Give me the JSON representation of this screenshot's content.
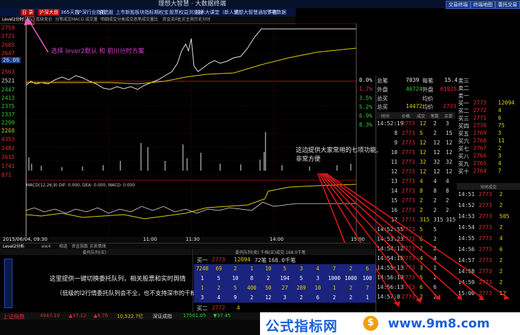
{
  "window": {
    "title": "理想大智慧 · 大数据终端",
    "right_buttons": [
      "交易终端",
      "终端地图",
      "委托交易"
    ]
  },
  "menu": {
    "items": [
      "目 录",
      "沪深大盘",
      "365天数",
      "沪深行业指数",
      "自选股",
      "上市新股",
      "板块指标",
      "期权宝",
      "股票权益浏览器",
      "技术大课堂（新人式）",
      "理想大智慧通软件官",
      "下载数据"
    ]
  },
  "tabs": [
    "Level2分时",
    "ADL",
    "连续竞价",
    "分笔成交",
    "MACD",
    "成交量",
    "明细成交",
    "分类成交",
    "逐笔成交",
    "量比",
    "资金流向",
    "主买主卖",
    "历史分时"
  ],
  "chart": {
    "left_prices": [
      {
        "v": "2759",
        "c": "r"
      },
      {
        "v": "2721",
        "c": "r"
      },
      {
        "v": "2685",
        "c": "r"
      },
      {
        "v": "2647",
        "c": "r"
      },
      {
        "v": "26.09",
        "c": "w"
      },
      {
        "v": "2563",
        "c": "r"
      },
      {
        "v": "2521",
        "c": "w"
      },
      {
        "v": "2447",
        "c": "g"
      },
      {
        "v": "2413",
        "c": "g"
      },
      {
        "v": "2375",
        "c": "g"
      },
      {
        "v": "2337",
        "c": "g"
      },
      {
        "v": "2299",
        "c": "g"
      },
      {
        "v": "2260",
        "c": "g"
      }
    ],
    "right_percents": [
      "0.0%",
      "1.7%",
      "3.5%",
      "5.2%",
      "6.9%",
      "8.3%"
    ],
    "volume_labels": [
      "5223",
      "4353",
      "3482",
      "2612",
      "1741",
      "871"
    ],
    "macd_header": "MACD(12,26,9) DIF: 0.000, DEA: 0.000, MACD: 0.000",
    "time_labels": [
      "11:00",
      "11:30",
      "14:00",
      "15:00"
    ],
    "current_time": "2015/06/04, 09:30"
  },
  "annotations": {
    "select_level2": "选择 lever2默认 和 前川分时方案",
    "seven_functions_1": "这边提供大家常用的七项功能,",
    "seven_functions_2": "非常方便",
    "one_key_1": "这里提供一键切换委托队列，相关股票和实时舆情",
    "one_key_2": "（低级的l2行情委托队列会不全，也不支持深市的千档）"
  },
  "right_panel": {
    "stats": [
      {
        "k1": "总笔",
        "v1": "7039",
        "k2": "每笔",
        "v2": "15.4"
      },
      {
        "k1": "外盘",
        "v1": "46724",
        "k2": "外盘",
        "v2": "61925"
      },
      {
        "k1": "总买",
        "v1": "",
        "k2": "均价",
        "v2": ""
      },
      {
        "k1": "总买",
        "v1": "14472",
        "k2": "均价",
        "v2": "2733"
      }
    ],
    "order_side": [
      {
        "k": "卖三",
        "v": ""
      },
      {
        "k": "卖二",
        "v": ""
      },
      {
        "k": "卖一",
        "v": ""
      },
      {
        "k": "买一",
        "v": "2773",
        "n": "12094"
      },
      {
        "k": "买二",
        "v": "2772",
        "n": "4"
      },
      {
        "k": "买三",
        "v": "2771",
        "n": "6"
      },
      {
        "k": "买四",
        "v": "2770",
        "n": "75"
      },
      {
        "k": "买五",
        "v": "2769",
        "n": "3"
      },
      {
        "k": "买六",
        "v": "2768",
        "n": "11"
      },
      {
        "k": "买七",
        "v": "2767",
        "n": "2"
      },
      {
        "k": "买八",
        "v": "2766",
        "n": "3"
      },
      {
        "k": "买九",
        "v": "2765",
        "n": "4"
      },
      {
        "k": "买十",
        "v": "2764",
        "n": "7"
      }
    ],
    "trades_header": [
      "时间",
      "价格",
      "成交",
      "笔数",
      "买单"
    ],
    "trades": [
      {
        "t": "14:52:19",
        "p": "2773",
        "v": "12",
        "n": "2",
        "b": "3"
      },
      {
        "t": "8",
        "p": "2773",
        "v": "5",
        "n": "2",
        "b": "15"
      },
      {
        "t": "9",
        "p": "2773",
        "v": "12",
        "n": "12",
        "b": "12"
      },
      {
        "t": "10",
        "p": "2773",
        "v": "12",
        "n": "12",
        "b": "12"
      },
      {
        "t": "11",
        "p": "2773",
        "v": "32",
        "n": "32",
        "b": "32"
      },
      {
        "t": "12",
        "p": "2773",
        "v": "12",
        "n": "12",
        "b": "12"
      },
      {
        "t": "13",
        "p": "2773",
        "v": "4",
        "n": "4",
        "b": "4"
      },
      {
        "t": "14",
        "p": "2773",
        "v": "8",
        "n": "8",
        "b": "8"
      },
      {
        "t": "15",
        "p": "2773",
        "v": "2",
        "n": "2",
        "b": "2"
      },
      {
        "t": "16",
        "p": "2773",
        "v": "2",
        "n": "2",
        "b": "2"
      },
      {
        "t": "17",
        "p": "2773",
        "v": "315",
        "n": "315",
        "b": "315"
      },
      {
        "t": "14:52:55",
        "p": "2773",
        "v": "5",
        "n": "5",
        "b": ""
      },
      {
        "t": "14:53:23",
        "p": "2773",
        "v": "6",
        "n": "2",
        "b": ""
      },
      {
        "t": "14:54:12",
        "p": "2773",
        "v": "2",
        "n": "2",
        "b": ""
      },
      {
        "t": "14:54:15",
        "p": "2773",
        "v": "4",
        "n": "4",
        "b": ""
      },
      {
        "t": "14:55:13",
        "p": "2773",
        "v": "3",
        "n": "1",
        "b": ""
      },
      {
        "t": "14:56:10",
        "p": "2773",
        "v": "5",
        "n": "2",
        "b": ""
      },
      {
        "t": "14:56:13",
        "p": "2773",
        "v": "6",
        "n": "6",
        "b": ""
      },
      {
        "t": "14:57:0",
        "p": "2773",
        "v": "2",
        "n": "2",
        "b": ""
      }
    ],
    "side_trades": [
      {
        "t": "14:51",
        "p": "2773",
        "v": "2"
      },
      {
        "t": "14:52",
        "p": "2773",
        "v": "2"
      },
      {
        "t": "14:53",
        "p": "2773",
        "v": "505"
      },
      {
        "t": "14:54",
        "p": "2773",
        "v": "2"
      },
      {
        "t": "14:55",
        "p": "2773",
        "v": "4"
      },
      {
        "t": "14:56",
        "p": "2773",
        "v": "6"
      },
      {
        "t": "14:57",
        "p": "2773",
        "v": "2"
      },
      {
        "t": "14:58",
        "p": "2773",
        "v": "2"
      },
      {
        "t": "14:59",
        "p": "2773",
        "v": "2"
      },
      {
        "t": "15:00",
        "p": "2773",
        "v": "12"
      }
    ],
    "side_header": "分时成交"
  },
  "bottom_tabs": [
    "Level2分析",
    "ww4",
    "相道",
    "资金指数",
    "买卖情绪"
  ],
  "queue": {
    "left_header": "委托队列(买)",
    "right_header": "委托队列(卖) 千档(买)成交 168.0千笔",
    "buy1": {
      "label": "买一",
      "price": "2773",
      "qty": "12094",
      "count": "72笔",
      "total": "168.0千笔"
    },
    "rows": [
      [
        "7248",
        "69",
        "2",
        "1",
        "10",
        "5",
        "3",
        "4",
        "7",
        "2",
        "6"
      ],
      [
        "1",
        "5",
        "10",
        "8",
        "2",
        "194",
        "5",
        "3",
        "1000",
        "1000",
        "100"
      ],
      [
        "1",
        "2",
        "5",
        "400",
        "50",
        "27",
        "289",
        "10",
        "1",
        "2",
        "7"
      ],
      [
        "3",
        "4",
        "9",
        "2",
        "12",
        "3",
        "2",
        "6",
        "2",
        "2",
        "1"
      ]
    ],
    "buy2": {
      "label": "买二",
      "price": "2772",
      "qty": "4"
    }
  },
  "footer": {
    "index_name": "上证指数",
    "index_value": "4947.10",
    "change": "▲37.12",
    "pct": "▲8.76",
    "amount": "10,522.7亿",
    "sz_name": "深证成指",
    "sz_value": "17501.05",
    "sz_change": "▼37.45"
  },
  "banner": {
    "text": "公式指标网",
    "url": "www.9m8.com"
  }
}
